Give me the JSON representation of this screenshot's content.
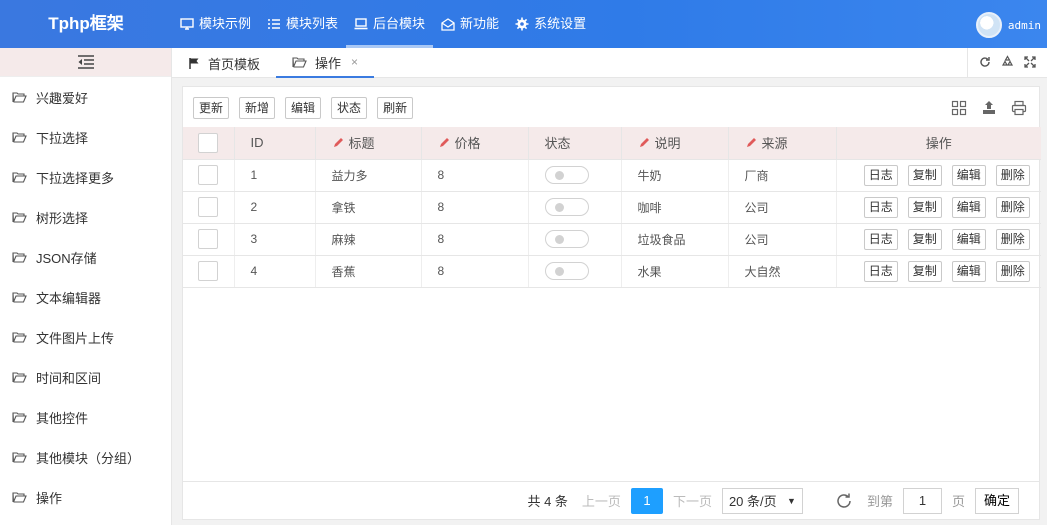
{
  "header": {
    "logo": "Tphp框架",
    "nav": [
      {
        "label": "模块示例",
        "icon": "monitor-icon"
      },
      {
        "label": "模块列表",
        "icon": "list-icon"
      },
      {
        "label": "后台模块",
        "icon": "laptop-icon"
      },
      {
        "label": "新功能",
        "icon": "mail-open-icon"
      },
      {
        "label": "系统设置",
        "icon": "gear-icon"
      }
    ],
    "active_nav": "后台模块",
    "username": "admin"
  },
  "sidebar": {
    "items": [
      {
        "label": "兴趣爱好"
      },
      {
        "label": "下拉选择"
      },
      {
        "label": "下拉选择更多"
      },
      {
        "label": "树形选择"
      },
      {
        "label": "JSON存储"
      },
      {
        "label": "文本编辑器"
      },
      {
        "label": "文件图片上传"
      },
      {
        "label": "时间和区间"
      },
      {
        "label": "其他控件"
      },
      {
        "label": "其他模块（分组）"
      },
      {
        "label": "操作"
      }
    ]
  },
  "tabs": [
    {
      "label": "首页模板",
      "icon": "flag-icon"
    },
    {
      "label": "操作",
      "icon": "folder-open-icon",
      "close": "×"
    }
  ],
  "toolbar": {
    "buttons": [
      "更新",
      "新增",
      "编辑",
      "状态",
      "刷新"
    ]
  },
  "table": {
    "headers": {
      "id": "ID",
      "title": "标题",
      "price": "价格",
      "status": "状态",
      "desc": "说明",
      "source": "来源",
      "actions": "操作"
    },
    "rows": [
      {
        "id": "1",
        "title": "益力多",
        "price": "8",
        "desc": "牛奶",
        "source": "厂商"
      },
      {
        "id": "2",
        "title": "拿铁",
        "price": "8",
        "desc": "咖啡",
        "source": "公司"
      },
      {
        "id": "3",
        "title": "麻辣",
        "price": "8",
        "desc": "垃圾食品",
        "source": "公司"
      },
      {
        "id": "4",
        "title": "香蕉",
        "price": "8",
        "desc": "水果",
        "source": "大自然"
      }
    ],
    "row_actions": [
      "日志",
      "复制",
      "编辑",
      "删除"
    ]
  },
  "pager": {
    "total": "共 4 条",
    "prev": "上一页",
    "current": "1",
    "next": "下一页",
    "page_size": "20 条/页",
    "goto_label": "到第",
    "goto_value": "1",
    "page_unit": "页",
    "confirm": "确定"
  },
  "colors": {
    "brand": "#3a78e0",
    "current_page": "#1e9fff",
    "header_row": "#f5eaea",
    "pencil": "#e05a5a"
  }
}
